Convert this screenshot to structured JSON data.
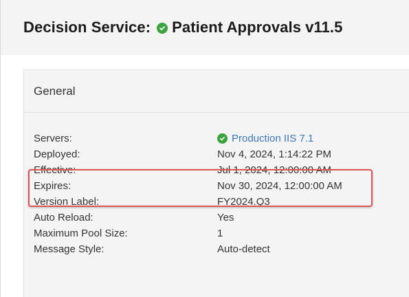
{
  "header": {
    "prefix": "Decision Service:",
    "status_icon": "check-circle-icon",
    "status_color": "#3aa33e",
    "service_name": "Patient Approvals",
    "version": "v11.5"
  },
  "panel": {
    "title": "General",
    "properties": [
      {
        "label": "Servers:",
        "value": "Production IIS 7.1",
        "link": true,
        "icon": "check-circle-icon"
      },
      {
        "label": "Deployed:",
        "value": "Nov 4, 2024, 1:14:22 PM"
      },
      {
        "label": "Effective:",
        "value": "Jul 1, 2024, 12:00:00 AM"
      },
      {
        "label": "Expires:",
        "value": "Nov 30, 2024, 12:00:00 AM"
      },
      {
        "label": "Version Label:",
        "value": "FY2024.Q3"
      },
      {
        "label": "Auto Reload:",
        "value": "Yes"
      },
      {
        "label": "Maximum Pool Size:",
        "value": "1"
      },
      {
        "label": "Message Style:",
        "value": "Auto-detect"
      }
    ]
  },
  "colors": {
    "link": "#3b78b8",
    "highlight_border": "#e05252",
    "success": "#3aa33e"
  }
}
